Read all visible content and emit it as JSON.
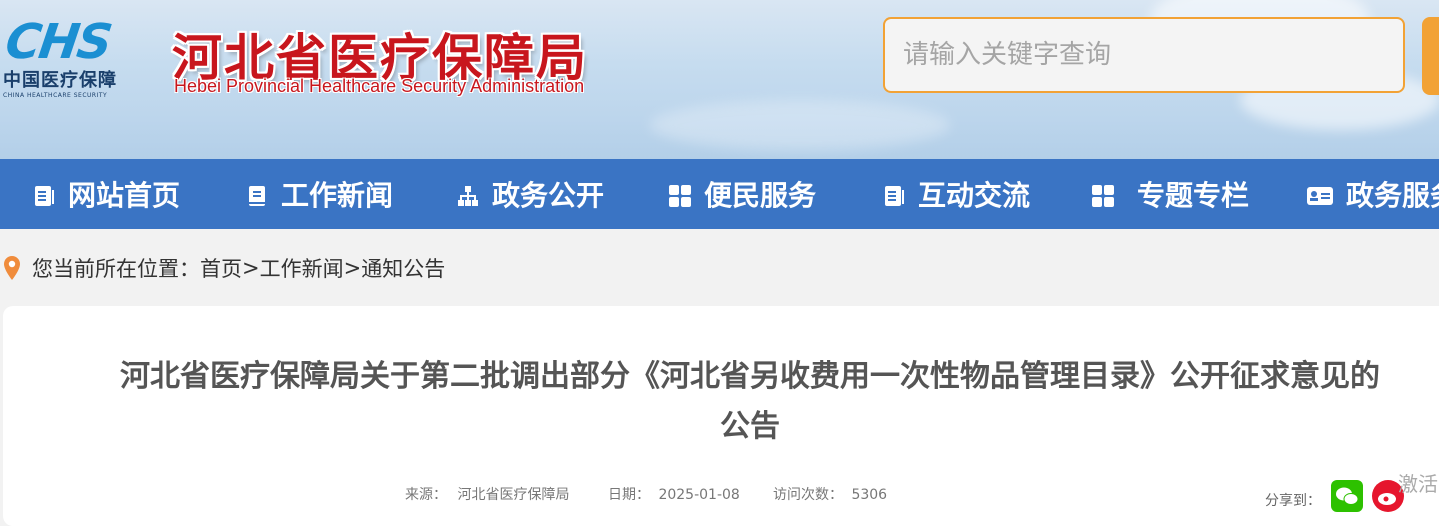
{
  "header": {
    "logo": {
      "abbr": "CHS",
      "cn": "中国医疗保障",
      "en": "CHINA HEALTHCARE SECURITY"
    },
    "org_cn": "河北省医疗保障局",
    "org_en": "Hebei Provincial Healthcare Security Administration"
  },
  "search": {
    "placeholder": "请输入关键字查询",
    "value": ""
  },
  "nav": {
    "items": [
      {
        "label": "网站首页",
        "icon": "document-icon"
      },
      {
        "label": "工作新闻",
        "icon": "bookmark-icon"
      },
      {
        "label": "政务公开",
        "icon": "sitemap-icon"
      },
      {
        "label": "便民服务",
        "icon": "grid-icon"
      },
      {
        "label": "互动交流",
        "icon": "document-icon"
      },
      {
        "label": "专题专栏",
        "icon": "grid-icon"
      },
      {
        "label": "政务服务",
        "icon": "id-card-icon"
      }
    ]
  },
  "breadcrumb": {
    "prefix": "您当前所在位置：",
    "items": [
      "首页",
      "工作新闻",
      "通知公告"
    ],
    "separator": ">"
  },
  "article": {
    "title_line1": "河北省医疗保障局关于第二批调出部分《河北省另收费用一次性物品管理目录》公开征求意见的",
    "title_line2": "公告",
    "source_label": "来源：",
    "source": "河北省医疗保障局",
    "date_label": "日期：",
    "date": "2025-01-08",
    "views_label": "访问次数：",
    "views": "5306"
  },
  "share": {
    "label": "分享到：",
    "icons": [
      "wechat-icon",
      "weibo-icon"
    ]
  },
  "side_tag": "激活",
  "colors": {
    "nav_bg": "#3a74c4",
    "org_red": "#c8161d",
    "search_border": "#f2a235",
    "logo_blue": "#1b8fd2",
    "pin_orange": "#f08c3c"
  }
}
